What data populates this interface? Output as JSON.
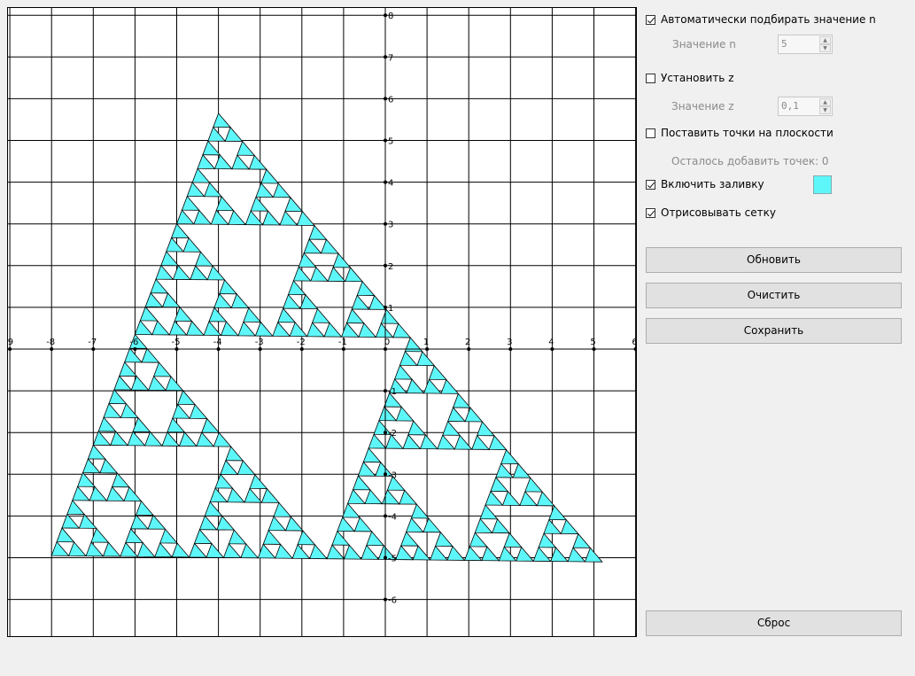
{
  "plot": {
    "x_ticks": [
      -9,
      -8,
      -7,
      -6,
      -5,
      -4,
      -3,
      -2,
      -1,
      0,
      1,
      2,
      3,
      4,
      5,
      6
    ],
    "y_ticks": [
      8,
      7,
      6,
      5,
      4,
      3,
      2,
      1,
      -1,
      -2,
      -3,
      -4,
      -5,
      -6
    ],
    "fractal": {
      "name": "Sierpinski triangle",
      "vertices": [
        [
          -8.0,
          -4.95
        ],
        [
          -4.0,
          5.65
        ],
        [
          5.2,
          -5.1
        ]
      ],
      "fill_color": "#5ef7f9",
      "outline_color": "#000000",
      "depth": 5
    }
  },
  "options": {
    "auto_n": {
      "label": "Автоматически подбирать значение n",
      "checked": true
    },
    "n_value": {
      "label": "Значение n",
      "value": "5"
    },
    "set_z": {
      "label": "Установить z",
      "checked": false
    },
    "z_value": {
      "label": "Значение z",
      "value": "0,1"
    },
    "place_points": {
      "label": "Поставить точки на плоскости",
      "checked": false
    },
    "points_left": {
      "label": "Осталось добавить точек: 0"
    },
    "fill": {
      "label": "Включить заливку",
      "checked": true,
      "color": "#5ef7f9"
    },
    "grid": {
      "label": "Отрисовывать сетку",
      "checked": true
    }
  },
  "buttons": {
    "refresh": "Обновить",
    "clear": "Очистить",
    "save": "Сохранить",
    "reset": "Сброс"
  }
}
